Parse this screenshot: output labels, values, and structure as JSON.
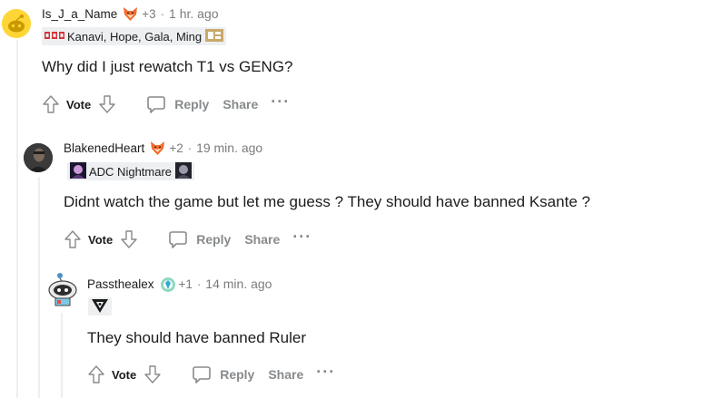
{
  "comments": [
    {
      "username": "Is_J_a_Name",
      "karma": "+3",
      "separator": "·",
      "time": "1 hr. ago",
      "flair_text": "Kanavi, Hope, Gala, Ming",
      "body": "Why did I just rewatch T1 vs GENG?",
      "vote_label": "Vote",
      "reply_label": "Reply",
      "share_label": "Share",
      "more_label": "···"
    },
    {
      "username": "BlakenedHeart",
      "karma": "+2",
      "separator": "·",
      "time": "19 min. ago",
      "flair_text": "ADC Nightmare",
      "body": "Didnt watch the game but let me guess ? They should have banned Ksante ?",
      "vote_label": "Vote",
      "reply_label": "Reply",
      "share_label": "Share",
      "more_label": "···"
    },
    {
      "username": "Passthealex",
      "karma": "+1",
      "separator": "·",
      "time": "14 min. ago",
      "flair_text": "",
      "body": "They should have banned Ruler",
      "vote_label": "Vote",
      "reply_label": "Reply",
      "share_label": "Share",
      "more_label": "···"
    }
  ],
  "colors": {
    "text_primary": "#1c1c1c",
    "text_meta": "#7c7c7c",
    "action_gray": "#878a8c",
    "flair_bg": "#edeff1",
    "thread_line": "#edeff1",
    "snoo_yellow": "#ffd635",
    "lng_red": "#d6343a",
    "rng_gold": "#c8a96a"
  }
}
